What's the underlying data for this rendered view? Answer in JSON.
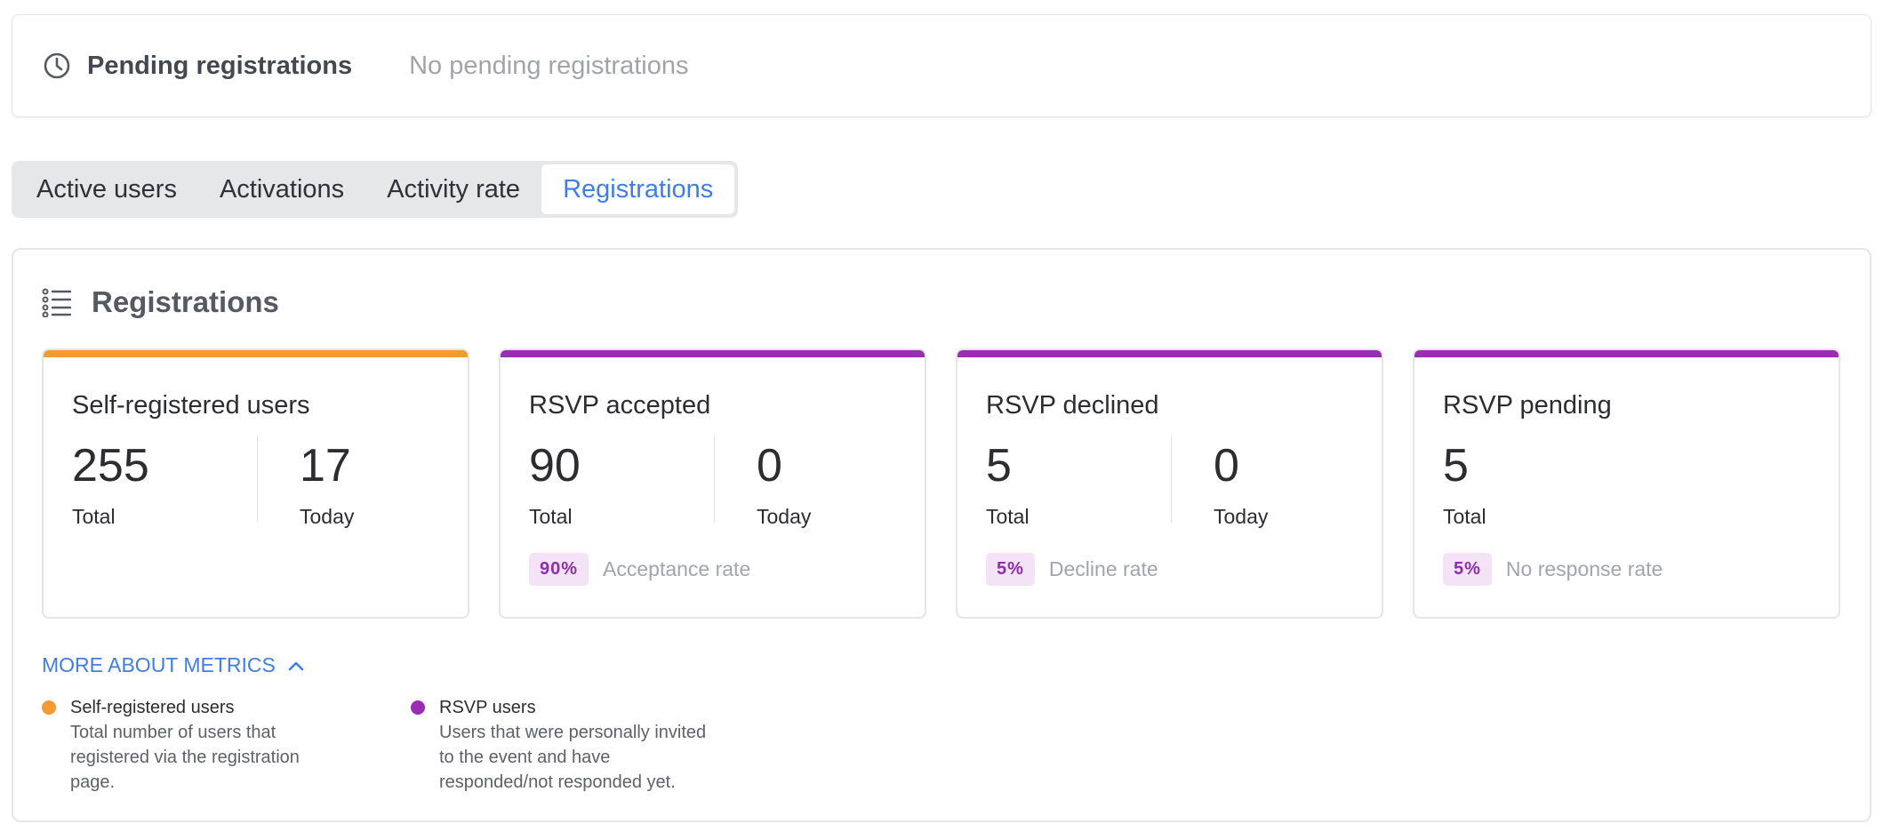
{
  "pending": {
    "title": "Pending registrations",
    "status": "No pending registrations",
    "icon": "clock-icon"
  },
  "tabs": [
    {
      "label": "Active users",
      "active": false
    },
    {
      "label": "Activations",
      "active": false
    },
    {
      "label": "Activity rate",
      "active": false
    },
    {
      "label": "Registrations",
      "active": true
    }
  ],
  "registrations": {
    "title": "Registrations",
    "icon": "list-icon",
    "cards": [
      {
        "title": "Self-registered users",
        "color": "#f39a30",
        "stats": [
          {
            "value": "255",
            "label": "Total"
          },
          {
            "value": "17",
            "label": "Today"
          }
        ]
      },
      {
        "title": "RSVP accepted",
        "color": "#9b2db5",
        "stats": [
          {
            "value": "90",
            "label": "Total"
          },
          {
            "value": "0",
            "label": "Today"
          }
        ],
        "rate": {
          "value": "90%",
          "label": "Acceptance rate"
        }
      },
      {
        "title": "RSVP declined",
        "color": "#9b2db5",
        "stats": [
          {
            "value": "5",
            "label": "Total"
          },
          {
            "value": "0",
            "label": "Today"
          }
        ],
        "rate": {
          "value": "5%",
          "label": "Decline rate"
        }
      },
      {
        "title": "RSVP pending",
        "color": "#9b2db5",
        "stats": [
          {
            "value": "5",
            "label": "Total"
          }
        ],
        "rate": {
          "value": "5%",
          "label": "No response rate"
        }
      }
    ],
    "more_link": "MORE ABOUT METRICS",
    "legend": [
      {
        "color": "#f39a30",
        "title": "Self-registered users",
        "desc_lines": [
          "Total number of users that",
          "registered via the registration",
          "page."
        ]
      },
      {
        "color": "#9b2db5",
        "title": "RSVP users",
        "desc_lines": [
          "Users that were personally invited",
          "to the event and have",
          "responded/not responded yet."
        ]
      }
    ]
  },
  "colors": {
    "accent": "#3d7ee8",
    "badge_bg": "#f4e3f7",
    "badge_text": "#8e2ea8"
  }
}
